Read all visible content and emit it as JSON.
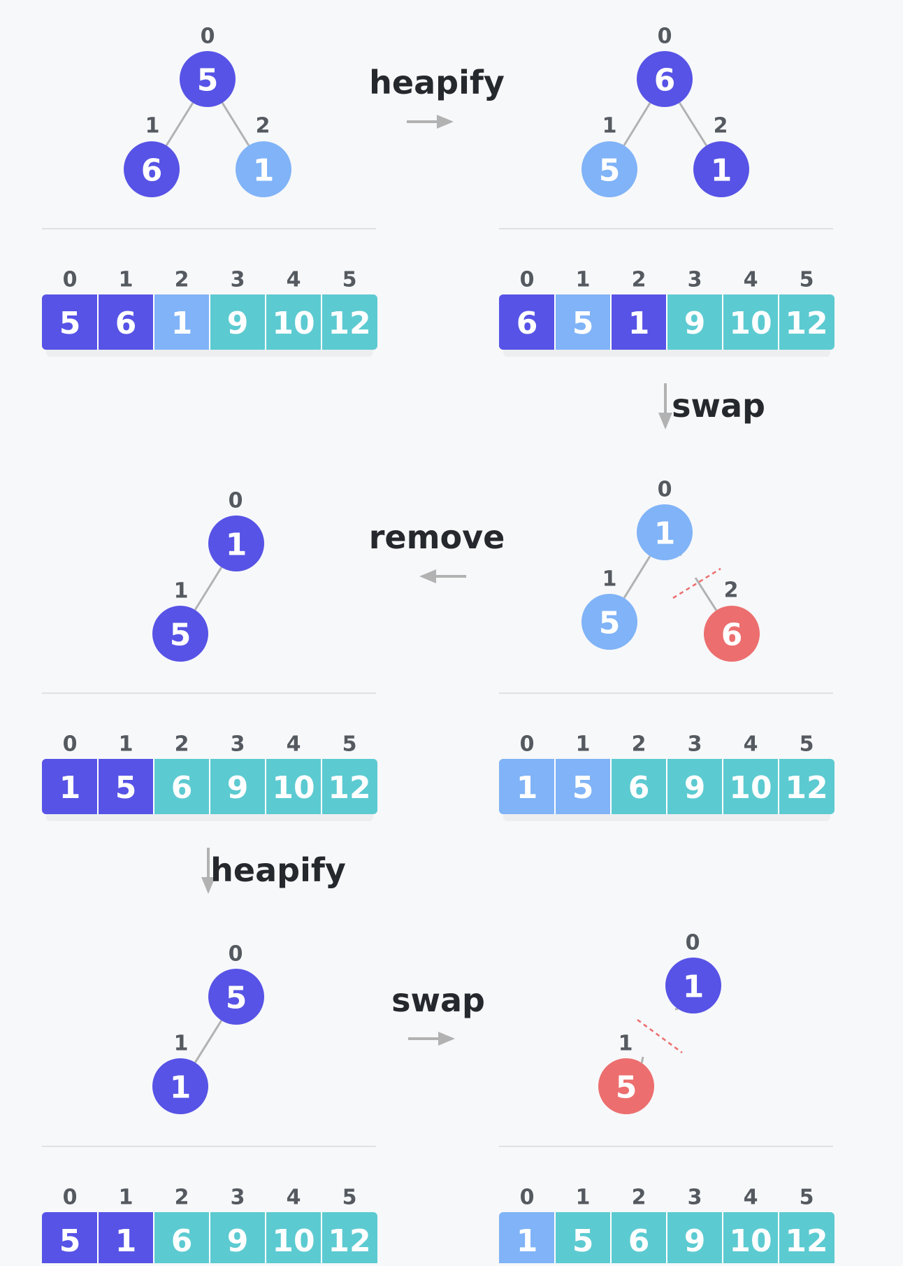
{
  "colors": {
    "background": "#f7f8fa",
    "heap_node": "#5753e6",
    "sorted_light": "#80b3f7",
    "teal": "#5ccad1",
    "removed": "#ec6e6e",
    "edge": "#b2b2b2",
    "cut": "#ec6e6e",
    "divider": "#dfe1e4",
    "arrow": "#b2b2b2",
    "label": "#25282c",
    "index": "#555a60"
  },
  "steps": [
    {
      "tree": {
        "nodes": [
          {
            "id": 0,
            "index": "0",
            "value": "5",
            "color": "heap"
          },
          {
            "id": 1,
            "index": "1",
            "value": "6",
            "color": "heap"
          },
          {
            "id": 2,
            "index": "2",
            "value": "1",
            "color": "light"
          }
        ]
      },
      "array": {
        "indices": [
          "0",
          "1",
          "2",
          "3",
          "4",
          "5"
        ],
        "values": [
          "5",
          "6",
          "1",
          "9",
          "10",
          "12"
        ],
        "colors": [
          "heap",
          "heap",
          "light",
          "teal",
          "teal",
          "teal"
        ]
      }
    },
    {
      "tree": {
        "nodes": [
          {
            "id": 0,
            "index": "0",
            "value": "6",
            "color": "heap"
          },
          {
            "id": 1,
            "index": "1",
            "value": "5",
            "color": "light"
          },
          {
            "id": 2,
            "index": "2",
            "value": "1",
            "color": "heap"
          }
        ]
      },
      "array": {
        "indices": [
          "0",
          "1",
          "2",
          "3",
          "4",
          "5"
        ],
        "values": [
          "6",
          "5",
          "1",
          "9",
          "10",
          "12"
        ],
        "colors": [
          "heap",
          "light",
          "heap",
          "teal",
          "teal",
          "teal"
        ]
      }
    },
    {
      "tree": {
        "nodes": [
          {
            "id": 0,
            "index": "0",
            "value": "1",
            "color": "light"
          },
          {
            "id": 1,
            "index": "1",
            "value": "5",
            "color": "light"
          },
          {
            "id": 2,
            "index": "2",
            "value": "6",
            "color": "removed"
          }
        ]
      },
      "array": {
        "indices": [
          "0",
          "1",
          "2",
          "3",
          "4",
          "5"
        ],
        "values": [
          "1",
          "5",
          "6",
          "9",
          "10",
          "12"
        ],
        "colors": [
          "light",
          "light",
          "teal",
          "teal",
          "teal",
          "teal"
        ]
      }
    },
    {
      "tree": {
        "nodes": [
          {
            "id": 0,
            "index": "0",
            "value": "1",
            "color": "heap"
          },
          {
            "id": 1,
            "index": "1",
            "value": "5",
            "color": "heap"
          }
        ]
      },
      "array": {
        "indices": [
          "0",
          "1",
          "2",
          "3",
          "4",
          "5"
        ],
        "values": [
          "1",
          "5",
          "6",
          "9",
          "10",
          "12"
        ],
        "colors": [
          "heap",
          "heap",
          "teal",
          "teal",
          "teal",
          "teal"
        ]
      }
    },
    {
      "tree": {
        "nodes": [
          {
            "id": 0,
            "index": "0",
            "value": "5",
            "color": "heap"
          },
          {
            "id": 1,
            "index": "1",
            "value": "1",
            "color": "heap"
          }
        ]
      },
      "array": {
        "indices": [
          "0",
          "1",
          "2",
          "3",
          "4",
          "5"
        ],
        "values": [
          "5",
          "1",
          "6",
          "9",
          "10",
          "12"
        ],
        "colors": [
          "heap",
          "heap",
          "teal",
          "teal",
          "teal",
          "teal"
        ]
      }
    },
    {
      "tree": {
        "nodes": [
          {
            "id": 0,
            "index": "0",
            "value": "1",
            "color": "heap"
          },
          {
            "id": 1,
            "index": "1",
            "value": "5",
            "color": "removed"
          }
        ]
      },
      "array": {
        "indices": [
          "0",
          "1",
          "2",
          "3",
          "4",
          "5"
        ],
        "values": [
          "1",
          "5",
          "6",
          "9",
          "10",
          "12"
        ],
        "colors": [
          "light",
          "teal",
          "teal",
          "teal",
          "teal",
          "teal"
        ]
      }
    }
  ],
  "operations": [
    {
      "label": "heapify",
      "direction": "right"
    },
    {
      "label": "swap",
      "direction": "down"
    },
    {
      "label": "remove",
      "direction": "left"
    },
    {
      "label": "heapify",
      "direction": "down"
    },
    {
      "label": "swap",
      "direction": "right"
    }
  ]
}
